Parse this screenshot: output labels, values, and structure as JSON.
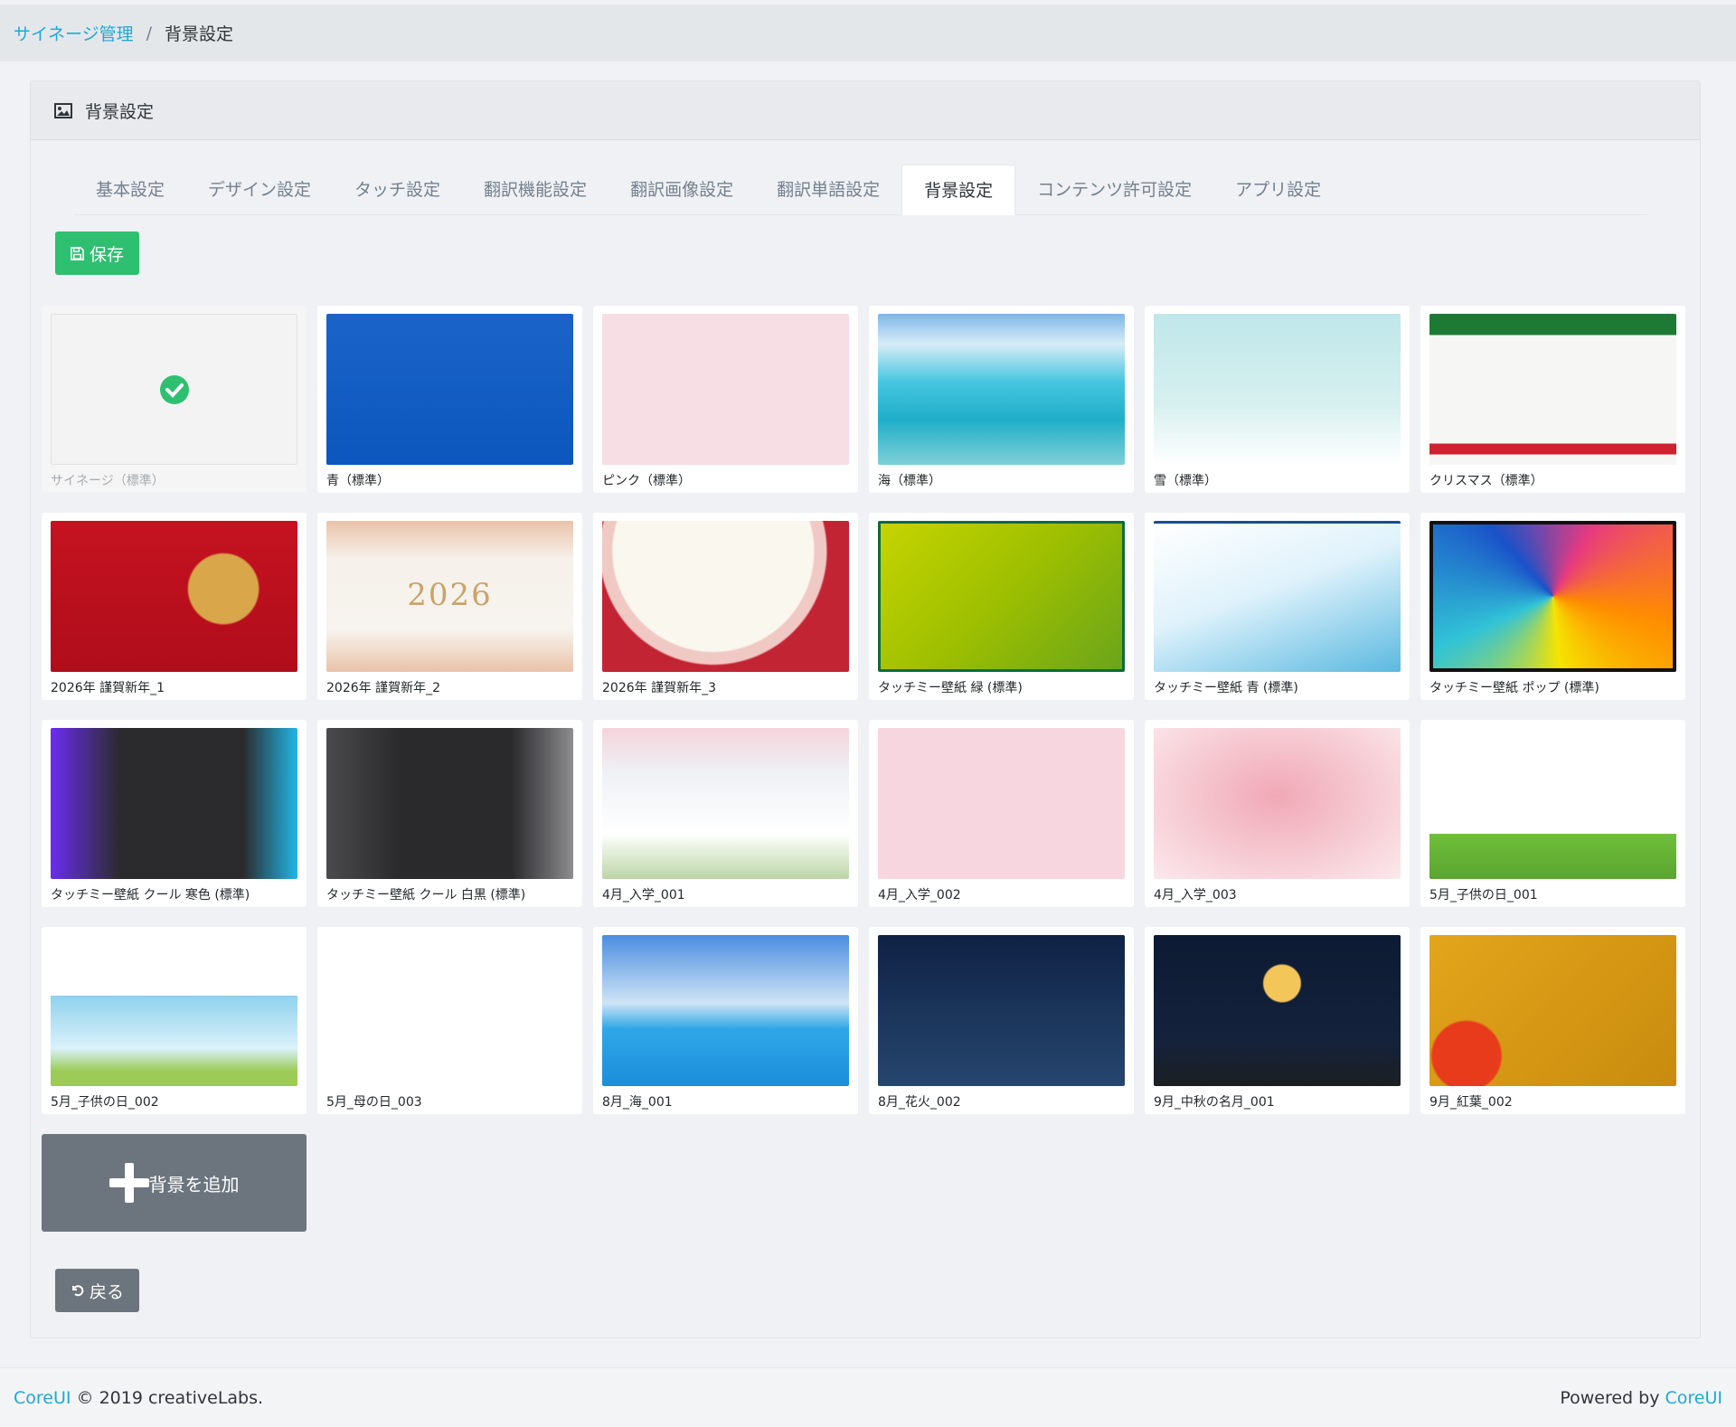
{
  "breadcrumb": {
    "root": "サイネージ管理",
    "separator": "/",
    "current": "背景設定"
  },
  "card": {
    "title": "背景設定",
    "header_icon": "image-icon"
  },
  "tabs": [
    "基本設定",
    "デザイン設定",
    "タッチ設定",
    "翻訳機能設定",
    "翻訳画像設定",
    "翻訳単語設定",
    "背景設定",
    "コンテンツ許可設定",
    "アプリ設定"
  ],
  "active_tab": "背景設定",
  "buttons": {
    "save": "保存",
    "add": "背景を追加",
    "back": "戻る"
  },
  "backgrounds": [
    {
      "label": "サイネージ（標準）",
      "selected": true,
      "style": "signage"
    },
    {
      "label": "青（標準）",
      "style": "blue"
    },
    {
      "label": "ピンク（標準）",
      "style": "pink"
    },
    {
      "label": "海（標準）",
      "style": "sea"
    },
    {
      "label": "雪（標準）",
      "style": "snow"
    },
    {
      "label": "クリスマス（標準）",
      "style": "xmas"
    },
    {
      "label": "2026年 謹賀新年_1",
      "style": "ny1"
    },
    {
      "label": "2026年 謹賀新年_2",
      "style": "ny2",
      "overlay": "2026"
    },
    {
      "label": "2026年 謹賀新年_3",
      "style": "ny3"
    },
    {
      "label": "タッチミー壁紙 緑 (標準)",
      "style": "green"
    },
    {
      "label": "タッチミー壁紙 青 (標準)",
      "style": "lightblue"
    },
    {
      "label": "タッチミー壁紙 ポップ (標準)",
      "style": "pop"
    },
    {
      "label": "タッチミー壁紙 クール 寒色 (標準)",
      "style": "coolcold"
    },
    {
      "label": "タッチミー壁紙 クール 白黒 (標準)",
      "style": "coolbw"
    },
    {
      "label": "4月_入学_001",
      "style": "school"
    },
    {
      "label": "4月_入学_002",
      "style": "kids"
    },
    {
      "label": "4月_入学_003",
      "style": "watercolor"
    },
    {
      "label": "5月_子供の日_001",
      "style": "koinobori"
    },
    {
      "label": "5月_子供の日_002",
      "style": "kodomo"
    },
    {
      "label": "5月_母の日_003",
      "style": "mother"
    },
    {
      "label": "8月_海_001",
      "style": "sea2"
    },
    {
      "label": "8月_花火_002",
      "style": "fireworks"
    },
    {
      "label": "9月_中秋の名月_001",
      "style": "moon"
    },
    {
      "label": "9月_紅葉_002",
      "style": "autumn"
    }
  ],
  "footer": {
    "brand": "CoreUI",
    "copyright": "© 2019 creativeLabs.",
    "powered_prefix": "Powered by",
    "powered_link": "CoreUI"
  }
}
